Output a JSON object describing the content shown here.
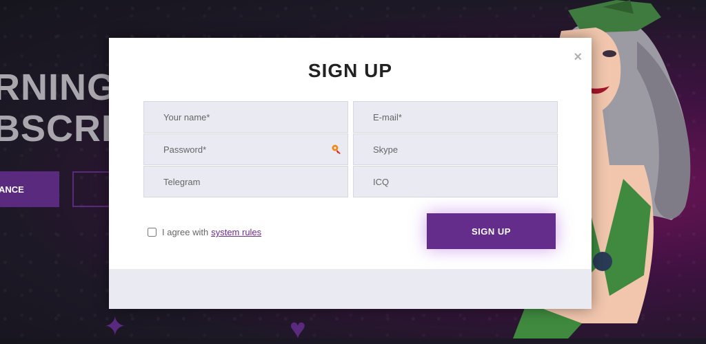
{
  "background": {
    "hero_line1": "RNING",
    "hero_line2": "BSCRI",
    "hero_button": "ANCE"
  },
  "modal": {
    "title": "SIGN UP",
    "close_symbol": "×",
    "fields": {
      "name": {
        "placeholder": "Your name*",
        "value": ""
      },
      "email": {
        "placeholder": "E-mail*",
        "value": ""
      },
      "password": {
        "placeholder": "Password*",
        "value": ""
      },
      "skype": {
        "placeholder": "Skype",
        "value": ""
      },
      "telegram": {
        "placeholder": "Telegram",
        "value": ""
      },
      "icq": {
        "placeholder": "ICQ",
        "value": ""
      }
    },
    "agree_text": "I agree with",
    "agree_link": "system rules",
    "agree_checked": false,
    "submit_label": "SIGN UP"
  },
  "colors": {
    "accent": "#642d8c",
    "field_bg": "#e9eaf2",
    "title": "#222222"
  },
  "icons": [
    "close-icon",
    "key-icon",
    "checkbox"
  ]
}
